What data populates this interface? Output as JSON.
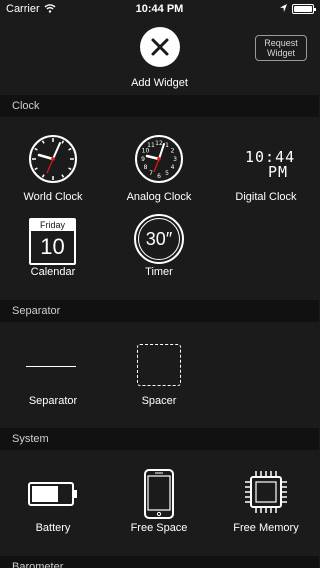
{
  "status": {
    "carrier": "Carrier",
    "time": "10:44 PM",
    "battery_level": 0.9
  },
  "header": {
    "add_label": "Add Widget",
    "request_button": "Request\nWidget"
  },
  "sections": {
    "clock": "Clock",
    "separator": "Separator",
    "system": "System",
    "barometer": "Barometer"
  },
  "clock_widgets": {
    "world_clock": "World Clock",
    "analog_clock": "Analog Clock",
    "digital_clock": "Digital Clock",
    "calendar": "Calendar",
    "timer": "Timer",
    "digital_time_line1": "10:44",
    "digital_time_line2": "PM",
    "calendar_day": "Friday",
    "calendar_date": "10",
    "timer_value": "30″"
  },
  "separator_widgets": {
    "separator": "Separator",
    "spacer": "Spacer"
  },
  "system_widgets": {
    "battery": "Battery",
    "free_space": "Free Space",
    "free_memory": "Free Memory"
  },
  "icons": [
    "wifi-icon",
    "location-arrow-icon",
    "battery-icon",
    "close-icon",
    "world-clock-icon",
    "analog-clock-icon",
    "calendar-icon",
    "timer-icon",
    "separator-line-icon",
    "spacer-icon",
    "battery-widget-icon",
    "phone-icon",
    "chip-icon"
  ]
}
